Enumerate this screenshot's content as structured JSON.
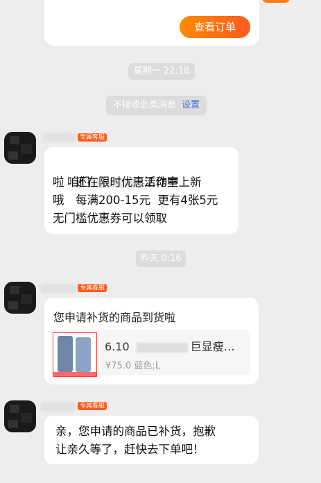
{
  "top_card": {
    "button_label": "查看订单"
  },
  "timestamps": {
    "first": "星期一 22:18",
    "second": "昨天 0:16"
  },
  "notice": {
    "text": "不接收此类消息",
    "link": "设置"
  },
  "badges": {
    "label": "专属客服"
  },
  "message1": {
    "line1": "咱们",
    "line1b": "工作室上新",
    "line2": "啦　还在限时优惠活动中",
    "line3": "哦　每满200-15元  更有4张5元",
    "line4": "无门槛优惠券可以领取"
  },
  "message2": {
    "title": "您申请补货的商品到货啦",
    "product_name_prefix": "6.10",
    "product_name_suffix": "巨显瘦…",
    "product_meta": "¥75.0 蓝色;L"
  },
  "message3": {
    "line1": "亲，您申请的商品已补货，抱歉",
    "line2": "让亲久等了，赶快去下单吧！"
  },
  "colors": {
    "accent": "#ff5a1f",
    "link": "#4b6fd6",
    "background": "#ededed"
  }
}
